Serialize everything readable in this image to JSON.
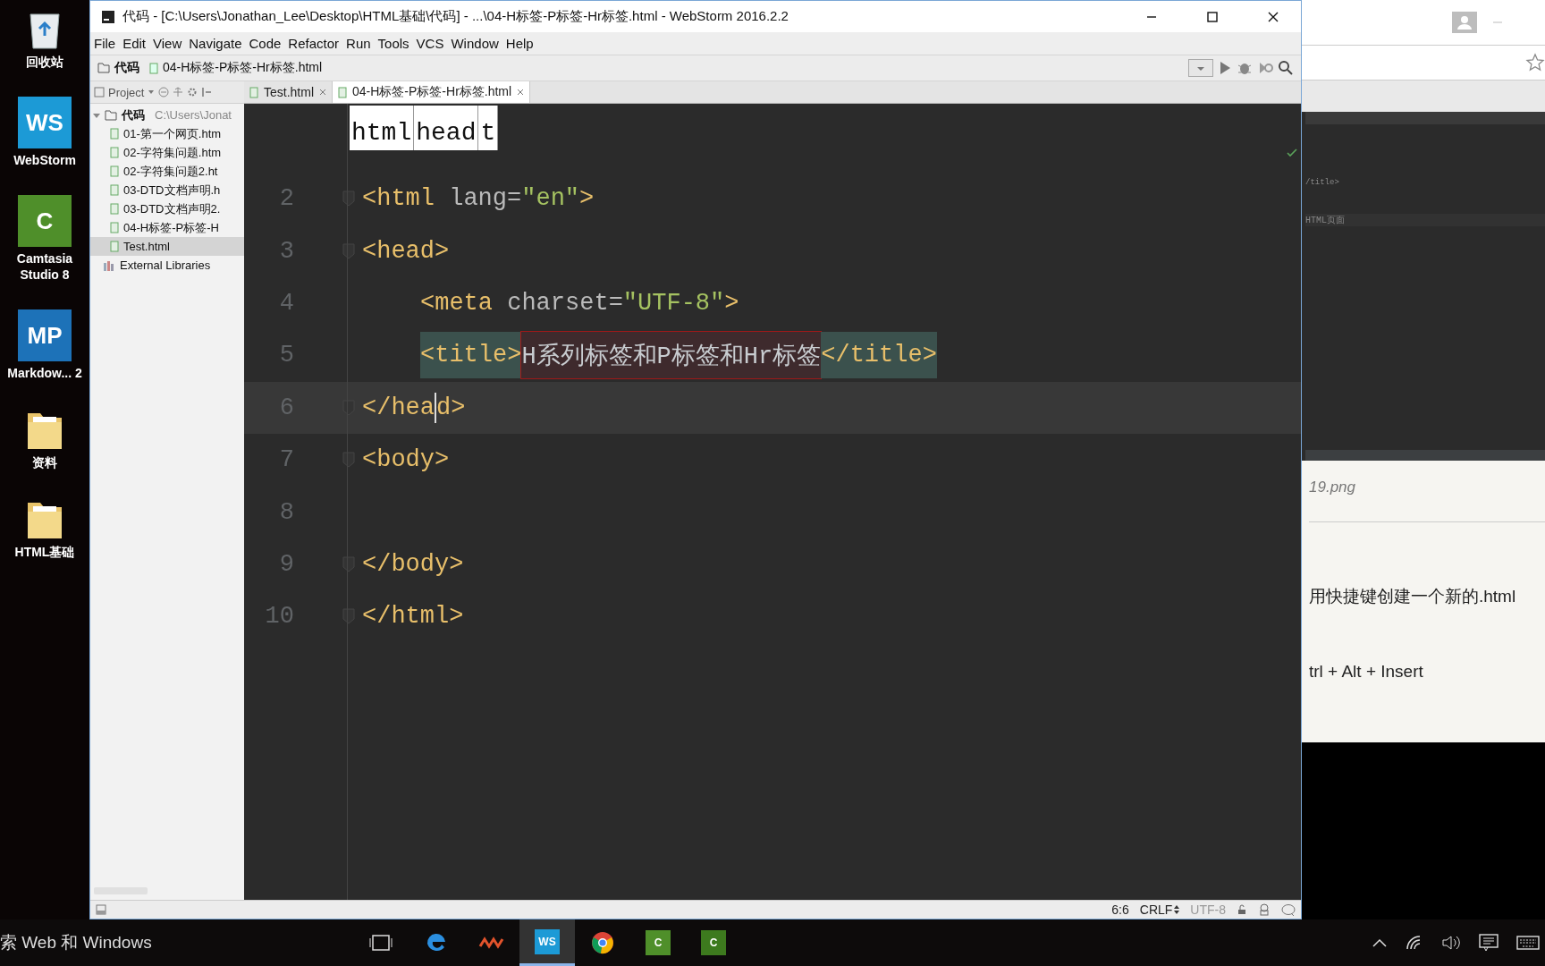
{
  "desktop_icons": [
    {
      "kind": "recycle",
      "label": "回收站"
    },
    {
      "kind": "app",
      "glyph": "WS",
      "color": "#1c9ad6",
      "label": "WebStorm"
    },
    {
      "kind": "app",
      "glyph": "C",
      "color": "#4f8f2a",
      "label": "Camtasia Studio 8"
    },
    {
      "kind": "app",
      "glyph": "MP",
      "color": "#1d72b8",
      "label": "Markdow... 2"
    },
    {
      "kind": "folder",
      "label": "资料"
    },
    {
      "kind": "folder",
      "label": "HTML基础"
    }
  ],
  "ide": {
    "title": "代码 - [C:\\Users\\Jonathan_Lee\\Desktop\\HTML基础\\代码] - ...\\04-H标签-P标签-Hr标签.html - WebStorm 2016.2.2",
    "menu": [
      "File",
      "Edit",
      "View",
      "Navigate",
      "Code",
      "Refactor",
      "Run",
      "Tools",
      "VCS",
      "Window",
      "Help"
    ],
    "breadcrumb": [
      "代码",
      "04-H标签-P标签-Hr标签.html"
    ],
    "project_label": "Project",
    "tree": {
      "label": "代码",
      "path": "C:\\Users\\Jonat",
      "expanded": true,
      "children": [
        {
          "label": "01-第一个网页.htm",
          "selected": false
        },
        {
          "label": "02-字符集问题.htm",
          "selected": false
        },
        {
          "label": "02-字符集问题2.ht",
          "selected": false
        },
        {
          "label": "03-DTD文档声明.h",
          "selected": false
        },
        {
          "label": "03-DTD文档声明2.",
          "selected": false
        },
        {
          "label": "04-H标签-P标签-H",
          "selected": false
        },
        {
          "label": "Test.html",
          "selected": true
        }
      ]
    },
    "libraries": "External Libraries",
    "tabs": [
      {
        "label": "Test.html",
        "selected": false
      },
      {
        "label": "04-H标签-P标签-Hr标签.html",
        "selected": true
      }
    ],
    "structure_popup": [
      "html",
      "head",
      "t"
    ],
    "lines": [
      {
        "number": "2",
        "current": false,
        "tokens": [
          {
            "kind": "tag",
            "text": "<html "
          },
          {
            "kind": "attr",
            "text": "lang="
          },
          {
            "kind": "string",
            "text": "\"en\""
          },
          {
            "kind": "tag",
            "text": ">"
          }
        ]
      },
      {
        "number": "3",
        "current": false,
        "tokens": [
          {
            "kind": "tag",
            "text": "<head>"
          }
        ]
      },
      {
        "number": "4",
        "current": false,
        "indented": true,
        "tokens": [
          {
            "kind": "tag",
            "text": "<meta "
          },
          {
            "kind": "attr",
            "text": "charset="
          },
          {
            "kind": "string",
            "text": "\"UTF-8\""
          },
          {
            "kind": "tag",
            "text": ">"
          }
        ]
      },
      {
        "number": "5",
        "current": false,
        "indented": true,
        "tokens": [
          {
            "kind": "tag",
            "text": "<title>",
            "highlighted": true
          },
          {
            "kind": "template",
            "text": "H系列标签和P标签和Hr标签"
          },
          {
            "kind": "tag",
            "text": "</title>",
            "highlighted": true
          }
        ]
      },
      {
        "number": "6",
        "current": true,
        "tokens": [
          {
            "kind": "tag",
            "text": "</hea"
          },
          {
            "kind": "caret"
          },
          {
            "kind": "tag",
            "text": "d>"
          }
        ]
      },
      {
        "number": "7",
        "current": false,
        "tokens": [
          {
            "kind": "tag",
            "text": "<body>"
          }
        ]
      },
      {
        "number": "8",
        "current": false
      },
      {
        "number": "9",
        "current": false,
        "tokens": [
          {
            "kind": "tag",
            "text": "</body>"
          }
        ]
      },
      {
        "number": "10",
        "current": false,
        "tokens": [
          {
            "kind": "tag",
            "text": "</html>"
          }
        ]
      }
    ],
    "status": {
      "position": "6:6",
      "line_separator": "CRLF",
      "encoding": "UTF-8"
    }
  },
  "browser": {
    "screenshot_texts": [
      "/title>",
      "HTML页面"
    ],
    "caption": "19.png",
    "paragraph": "用快捷键创建一个新的.html",
    "shortcut": "trl + Alt + Insert"
  },
  "taskbar": {
    "search": "索 Web 和 Windows",
    "apps": [
      {
        "kind": "taskview",
        "active": false
      },
      {
        "kind": "edge",
        "active": false
      },
      {
        "kind": "wave",
        "active": false
      },
      {
        "kind": "glyph",
        "glyph": "WS",
        "color": "#1c9ad6",
        "active": true
      },
      {
        "kind": "chrome",
        "active": false
      },
      {
        "kind": "glyph",
        "glyph": "C",
        "color": "#4f8f2a",
        "active": false
      },
      {
        "kind": "glyph",
        "glyph": "C",
        "color": "#3d7a1e",
        "active": false
      }
    ]
  }
}
